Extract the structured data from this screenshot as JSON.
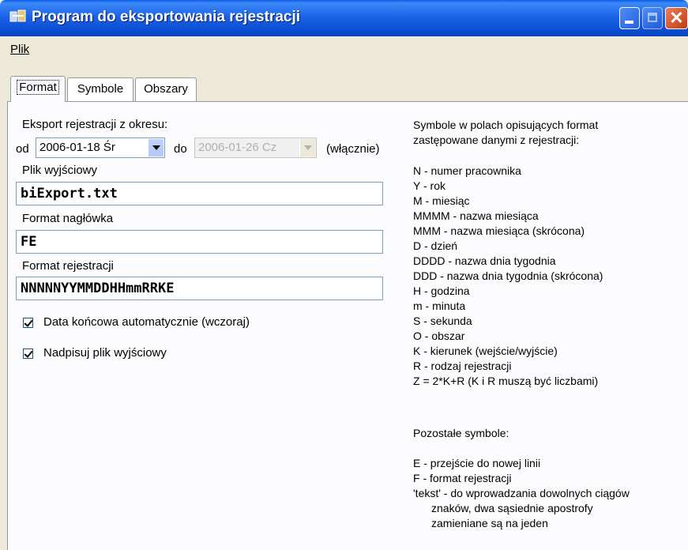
{
  "window": {
    "title": "Program do eksportowania rejestracji"
  },
  "menu": {
    "items": [
      "Plik"
    ]
  },
  "tabs": [
    {
      "label": "Format"
    },
    {
      "label": "Symbole"
    },
    {
      "label": "Obszary"
    }
  ],
  "export": {
    "period_label": "Eksport rejestracji z okresu:",
    "from_label": "od",
    "from_value": "2006-01-18  Śr",
    "to_label": "do",
    "to_value": "2006-01-26  Cz",
    "inclusive_label": "(włącznie)"
  },
  "output_file": {
    "label": "Plik wyjściowy",
    "value": "biExport.txt"
  },
  "header_format": {
    "label": "Format nagłówka",
    "value": "FE"
  },
  "record_format": {
    "label": "Format rejestracji",
    "value": "NNNNNYYMMDDHHmmRRKE"
  },
  "options": [
    {
      "label": "Data końcowa automatycznie (wczoraj)",
      "checked": true
    },
    {
      "label": "Nadpisuj plik wyjściowy",
      "checked": true
    }
  ],
  "help": {
    "intro": [
      "Symbole w polach opisujących format",
      "zastępowane danymi z rejestracji:"
    ],
    "symbols": [
      "N - numer pracownika",
      "Y - rok",
      "M - miesiąc",
      "MMMM - nazwa miesiąca",
      "MMM - nazwa miesiąca (skrócona)",
      "D - dzień",
      "DDDD - nazwa dnia tygodnia",
      "DDD - nazwa dnia tygodnia (skrócona)",
      "H - godzina",
      "m - minuta",
      "S - sekunda",
      "O - obszar",
      "K - kierunek (wejście/wyjście)",
      "R - rodzaj rejestracji",
      "Z = 2*K+R (K i R muszą być liczbami)"
    ],
    "other_heading": "Pozostałe symbole:",
    "other": [
      "E - przejście do nowej linii",
      "F - format rejestracji",
      "'tekst' - do wprowadzania dowolnych ciągów",
      "znaków, dwa sąsiednie apostrofy",
      "zamieniane są na jeden"
    ]
  }
}
